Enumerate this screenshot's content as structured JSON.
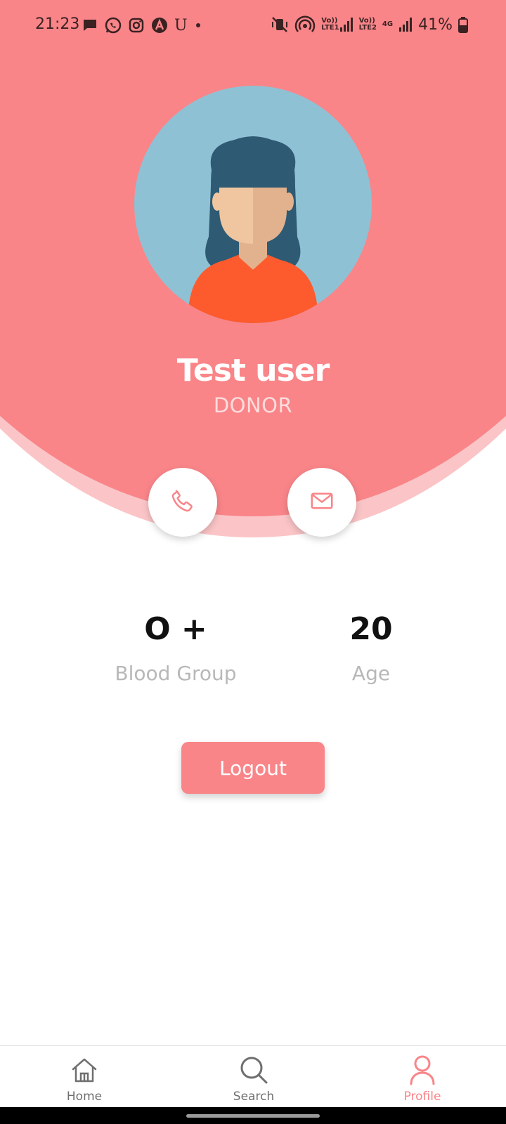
{
  "status_bar": {
    "time": "21:23",
    "left_icons": [
      "message-icon",
      "whatsapp-icon",
      "instagram-icon",
      "app-a-icon",
      "app-u-icon",
      "dot-icon"
    ],
    "right_icons": [
      "vibrate-mute-icon",
      "hotspot-icon",
      "volte-lte1-signal-icon",
      "volte-lte2-signal-icon",
      "4g-data-icon",
      "signal-icon",
      "battery-icon"
    ],
    "lte1": "LTE1",
    "lte2": "LTE2",
    "volte": "Vo))",
    "network_type": "4G",
    "battery": "41%"
  },
  "profile": {
    "name": "Test user",
    "role": "DONOR",
    "avatar": "female-avatar"
  },
  "actions": {
    "call_icon": "phone-icon",
    "mail_icon": "mail-icon"
  },
  "stats": {
    "blood_group_value": "O +",
    "blood_group_label": "Blood Group",
    "age_value": "20",
    "age_label": "Age"
  },
  "logout_label": "Logout",
  "nav": {
    "items": [
      {
        "label": "Home",
        "icon": "home-icon",
        "active": false
      },
      {
        "label": "Search",
        "icon": "search-icon",
        "active": false
      },
      {
        "label": "Profile",
        "icon": "user-icon",
        "active": true
      }
    ]
  },
  "colors": {
    "primary": "#f98589",
    "primary_light": "#fbc5c7",
    "avatar_bg": "#8fc1d4",
    "inactive": "#6f6f6f",
    "label_gray": "#b8b8b8"
  }
}
